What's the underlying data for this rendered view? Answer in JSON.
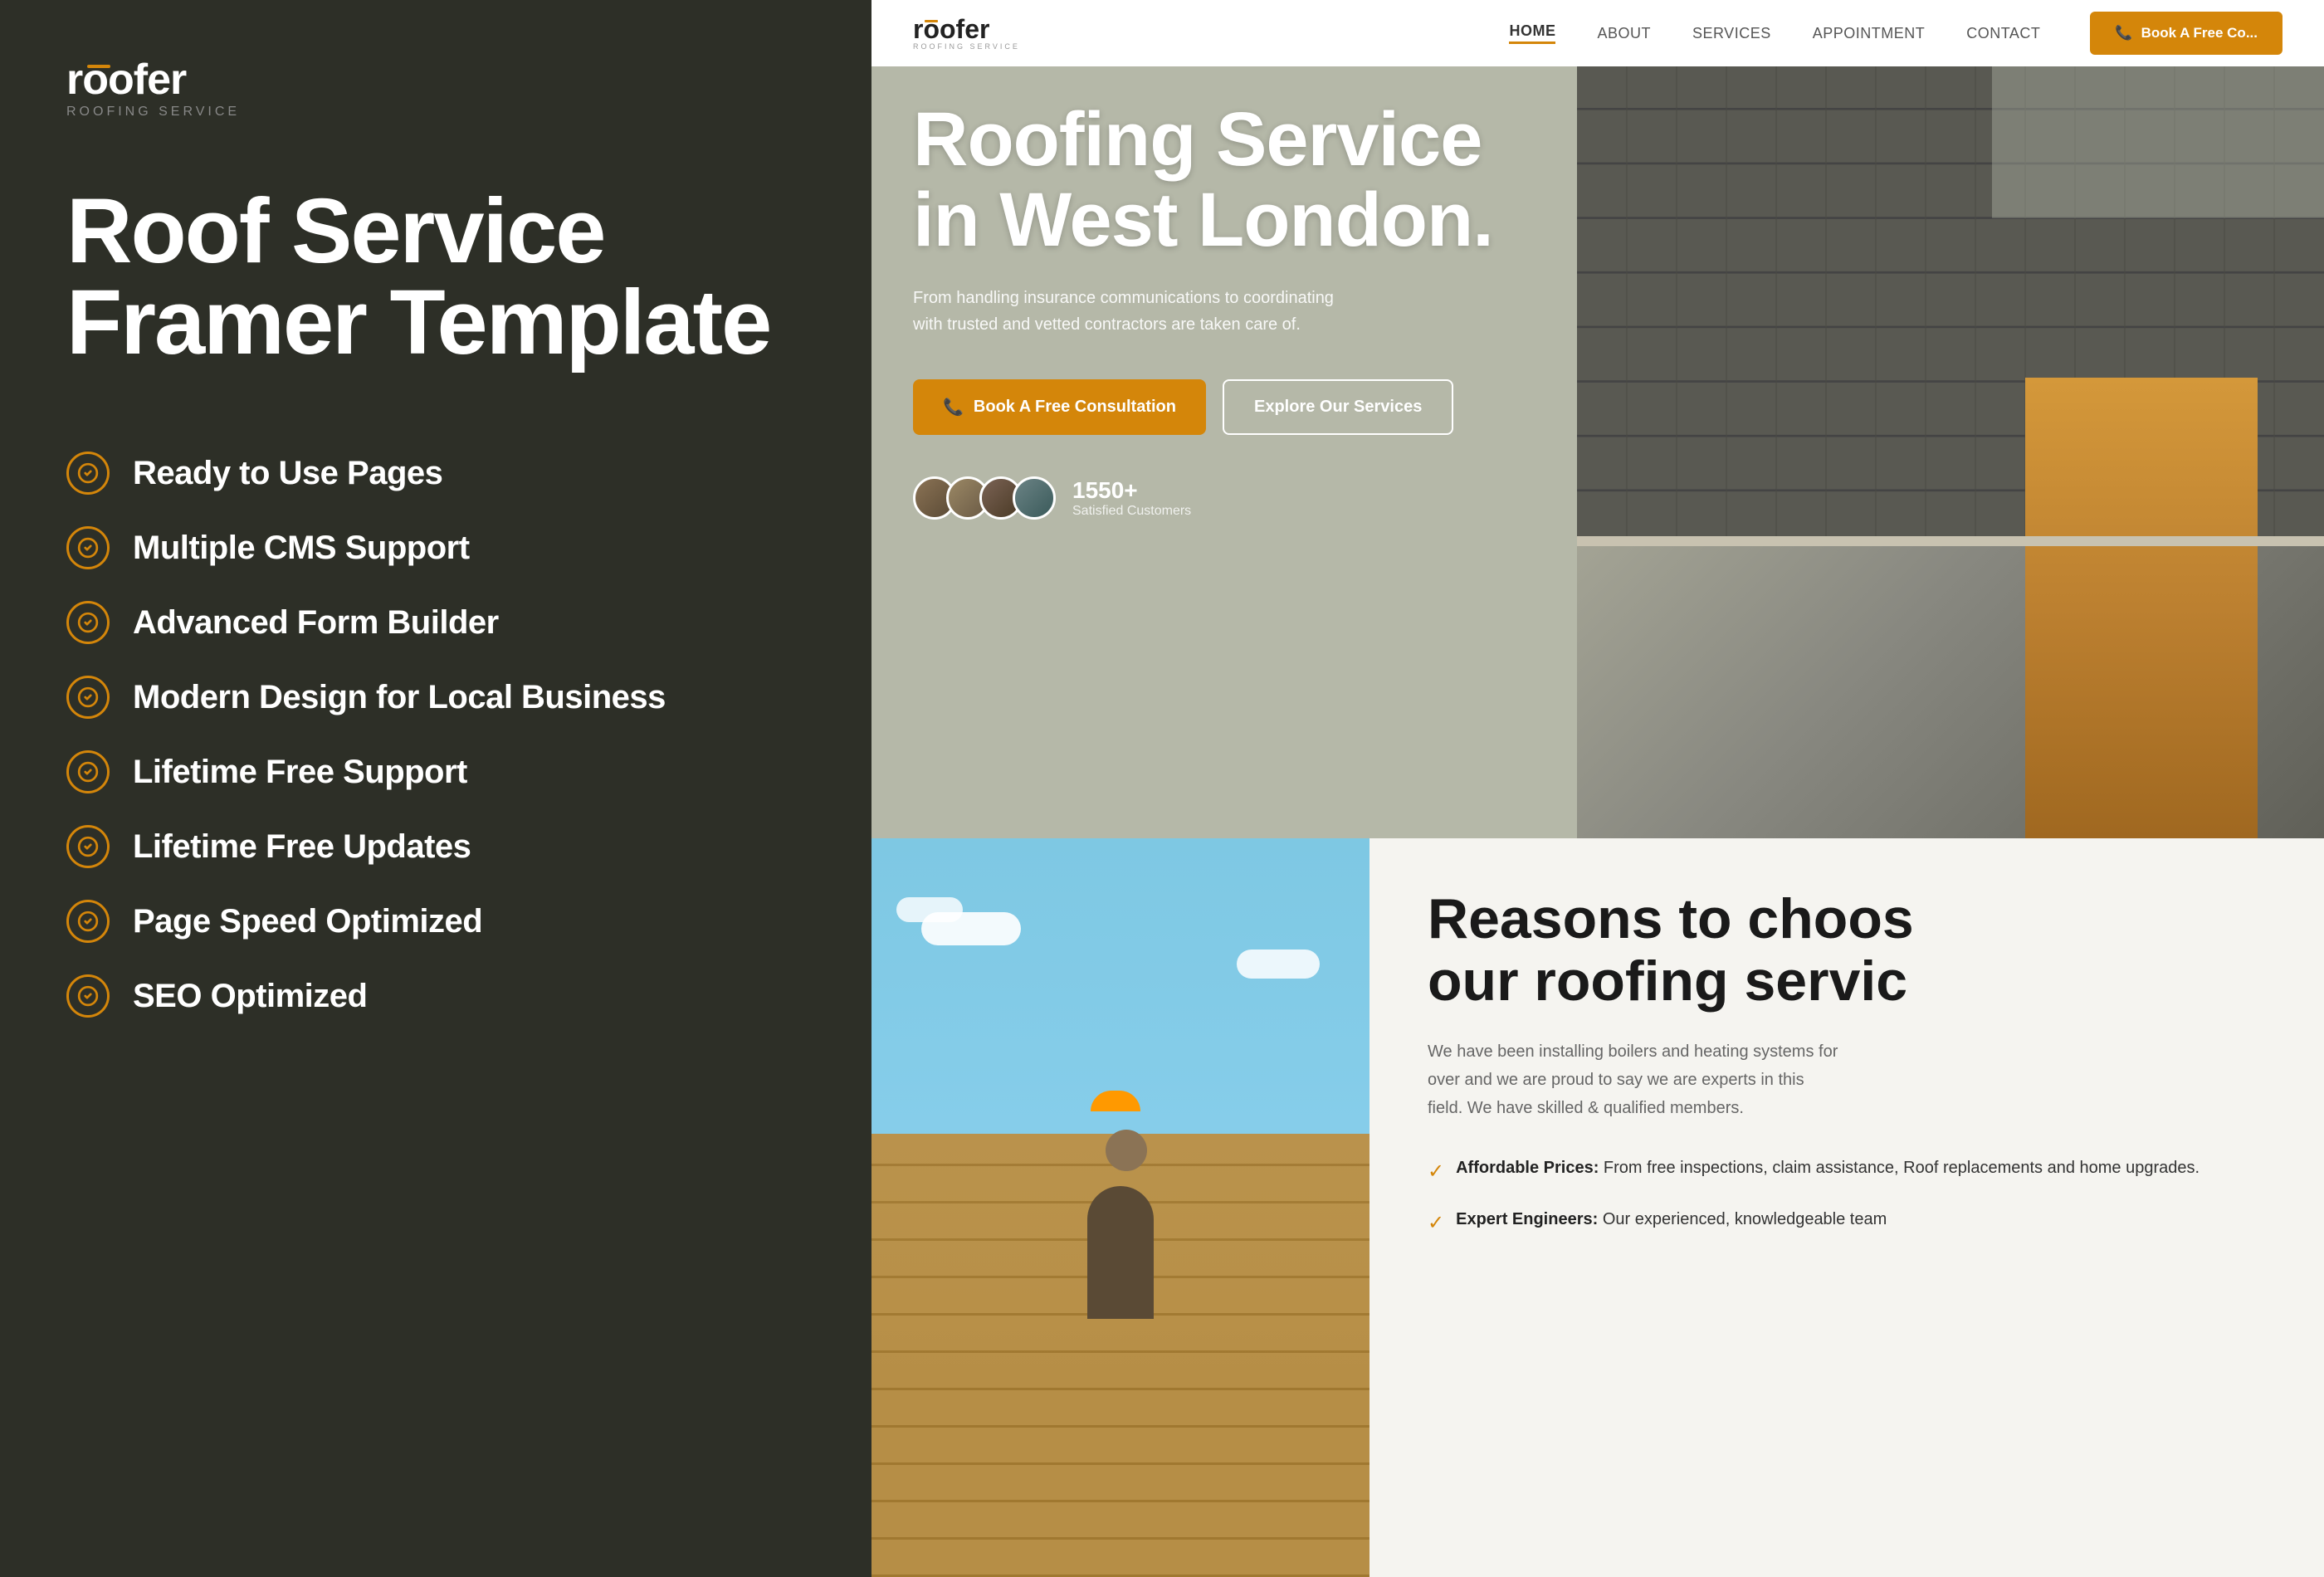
{
  "left": {
    "logo": {
      "text": "roofer",
      "subtitle": "ROOFING SERVICE"
    },
    "main_title_line1": "Roof Service",
    "main_title_line2": "Framer Template",
    "features": [
      {
        "id": "ready-pages",
        "text": "Ready to Use Pages"
      },
      {
        "id": "cms-support",
        "text": "Multiple CMS Support"
      },
      {
        "id": "form-builder",
        "text": "Advanced Form Builder"
      },
      {
        "id": "modern-design",
        "text": "Modern Design for Local Business"
      },
      {
        "id": "lifetime-support",
        "text": "Lifetime Free Support"
      },
      {
        "id": "lifetime-updates",
        "text": "Lifetime Free Updates"
      },
      {
        "id": "page-speed",
        "text": "Page Speed Optimized"
      },
      {
        "id": "seo",
        "text": "SEO Optimized"
      }
    ]
  },
  "right": {
    "nav": {
      "logo_text": "roofer",
      "logo_subtitle": "ROOFING SERVICE",
      "links": [
        {
          "label": "HOME",
          "active": true
        },
        {
          "label": "ABOUT",
          "active": false
        },
        {
          "label": "SERVICES",
          "active": false
        },
        {
          "label": "APPOINTMENT",
          "active": false
        },
        {
          "label": "CONTACT",
          "active": false
        }
      ],
      "cta_button": "Book A Free Co..."
    },
    "hero": {
      "title_line1": "Roofing Service",
      "title_line2": "in West London.",
      "subtitle": "From handling insurance communications to coordinating with trusted and vetted contractors are taken care of.",
      "btn_primary": "Book A Free Consultation",
      "btn_secondary": "Explore Our Services",
      "stats_number": "1550+",
      "stats_label": "Satisfied Customers"
    },
    "bottom": {
      "section_title_line1": "Reasons to choos",
      "section_title_line2": "our roofing servic",
      "description": "We have been installing boilers and heating systems for over and we are proud to say we are experts in this field. We have skilled & qualified members.",
      "features": [
        {
          "title": "Affordable Prices:",
          "text": "From free inspections, claim assistance, Roof replacements and home upgrades."
        },
        {
          "title": "Expert Engineers:",
          "text": "Our experienced, knowledgeable team"
        }
      ]
    }
  }
}
